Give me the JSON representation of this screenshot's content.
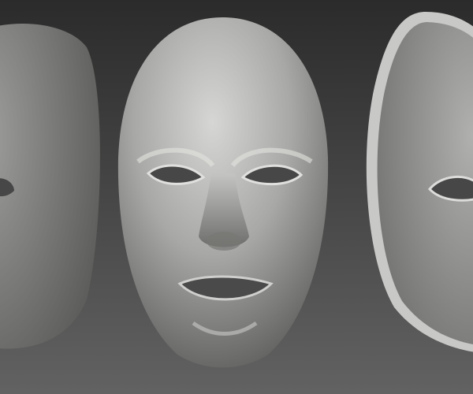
{
  "colors": {
    "background_top": "#2b2b2b",
    "background_bottom": "#626262",
    "mask_light": "#d8d8d6",
    "mask_mid": "#9a9a98",
    "mask_dark": "#5a5a58",
    "hole": "#454545"
  }
}
